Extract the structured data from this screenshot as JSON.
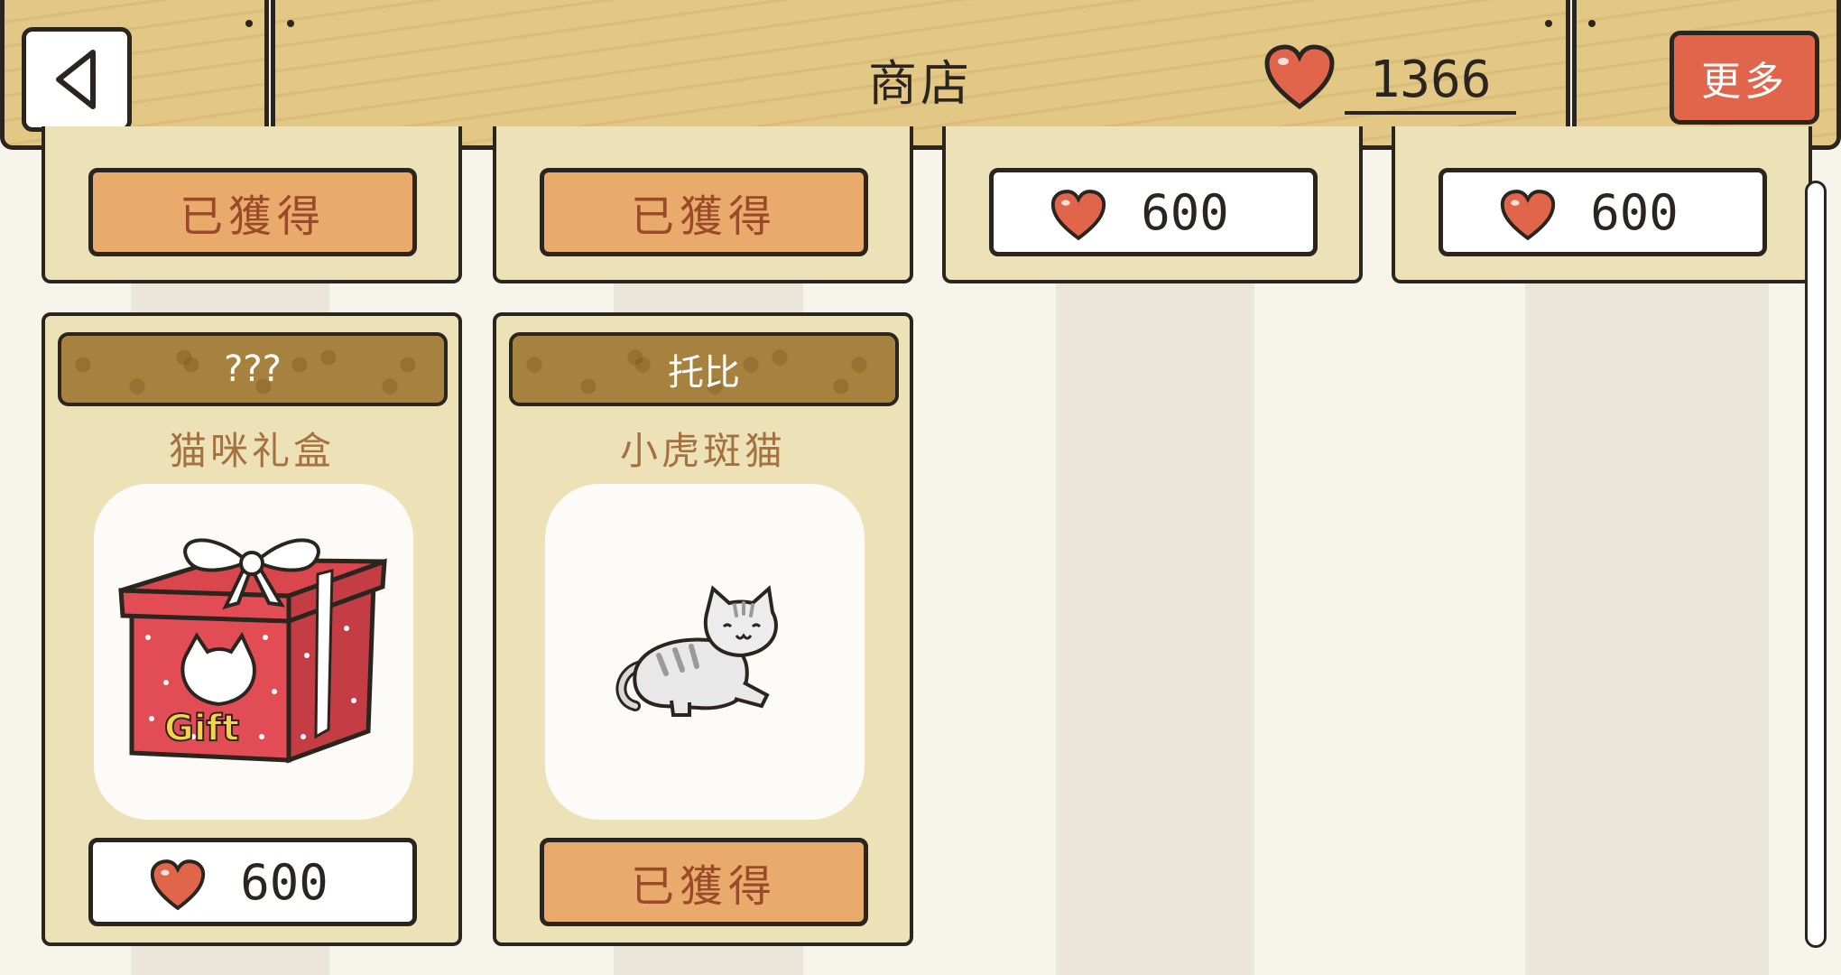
{
  "header": {
    "title": "商店",
    "hearts": "1366",
    "more_label": "更多"
  },
  "top_row": [
    {
      "status": "已獲得"
    },
    {
      "status": "已獲得"
    },
    {
      "price": "600"
    },
    {
      "price": "600"
    }
  ],
  "items": [
    {
      "banner": "???",
      "name": "猫咪礼盒",
      "price": "600",
      "image": "gift-box-icon"
    },
    {
      "banner": "托比",
      "name": "小虎斑猫",
      "status": "已獲得",
      "image": "tabby-cat-icon"
    }
  ],
  "colors": {
    "wood": "#e3c785",
    "accent_red": "#e0654a",
    "owned_orange": "#e8ab6b",
    "card_bg": "#ede1b8",
    "banner_brown": "#a6823e"
  }
}
